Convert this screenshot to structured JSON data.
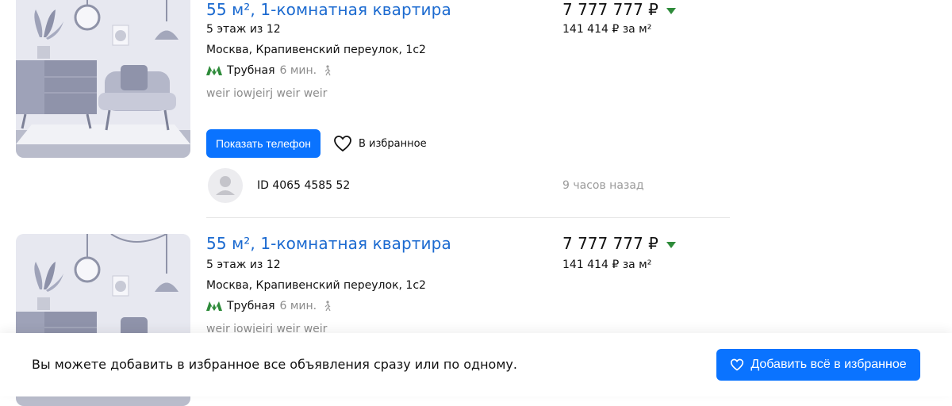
{
  "listings": [
    {
      "title": "55 м², 1-комнатная квартира",
      "floor": "5 этаж из 12",
      "address": "Москва, Крапивенский переулок, 1с2",
      "metro": {
        "station": "Трубная",
        "walk": "6 мин."
      },
      "description": "weir iowjeirj weir weir",
      "price": "7 777 777 ₽",
      "price_per_m2": "141 414 ₽ за м²",
      "show_phone_label": "Показать телефон",
      "favorite_label": "В избранное",
      "owner_id": "ID 4065 4585 52",
      "time_ago": "9 часов назад"
    },
    {
      "title": "55 м², 1-комнатная квартира",
      "floor": "5 этаж из 12",
      "address": "Москва, Крапивенский переулок, 1с2",
      "metro": {
        "station": "Трубная",
        "walk": "6 мин."
      },
      "description": "weir iowjeirj weir weir",
      "price": "7 777 777 ₽",
      "price_per_m2": "141 414 ₽ за м²"
    }
  ],
  "bottom_bar": {
    "text": "Вы можете добавить в избранное все объявления сразу или по одному.",
    "add_all_label": "Добавить всё в избранное"
  },
  "colors": {
    "accent": "#0a73ff",
    "title_link": "#1b6ad0",
    "metro": "#2e8b3a",
    "price_trend": "#2e8b3a"
  }
}
